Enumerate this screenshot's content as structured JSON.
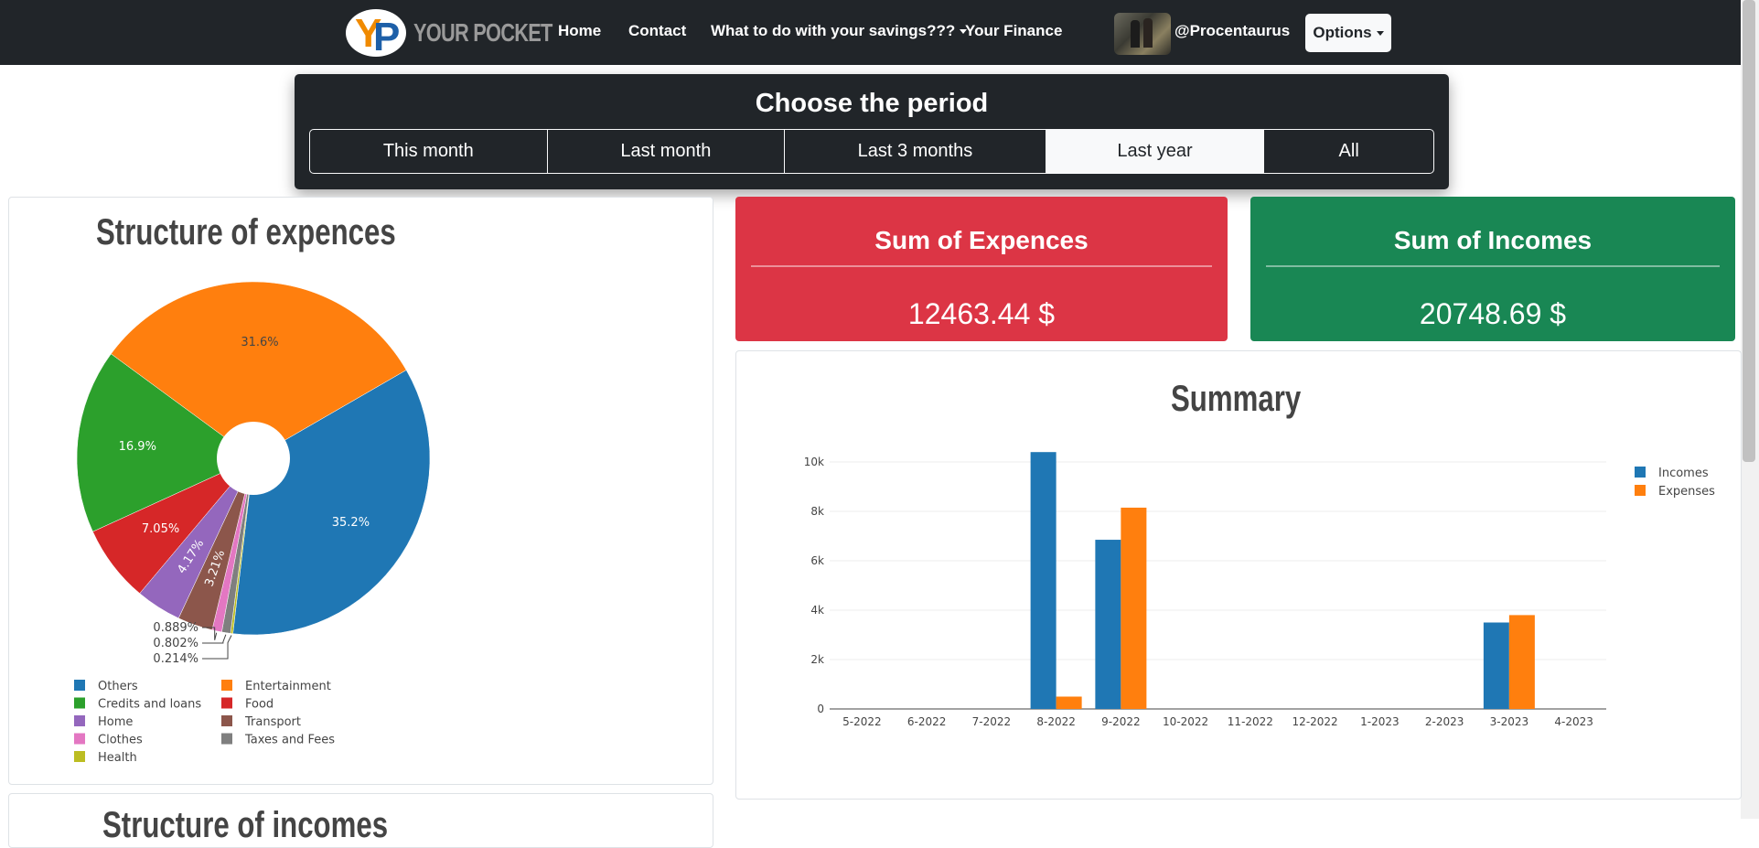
{
  "navbar": {
    "brand_text": "YOUR POCKET",
    "links": [
      {
        "label": "Home"
      },
      {
        "label": "Contact"
      },
      {
        "label": "What to do with your savings???"
      },
      {
        "label": "Your Finance"
      }
    ],
    "username": "@Procentaurus",
    "options_label": "Options"
  },
  "period": {
    "title": "Choose the period",
    "buttons": [
      "This month",
      "Last month",
      "Last 3 months",
      "Last year",
      "All"
    ],
    "active": "Last year"
  },
  "expenses_card": {
    "title": "Structure of expences",
    "next_title": "Structure of incomes"
  },
  "sum_expenses": {
    "title": "Sum of Expences",
    "value": "12463.44 $",
    "color": "#dc3545"
  },
  "sum_incomes": {
    "title": "Sum of Incomes",
    "value": "20748.69 $",
    "color": "#198754"
  },
  "summary_card": {
    "title": "Summary"
  },
  "chart_data": [
    {
      "type": "pie",
      "title": "Structure of expences",
      "hole": true,
      "slices": [
        {
          "label": "Others",
          "value": 35.2,
          "text": "35.2%",
          "color": "#1f77b4"
        },
        {
          "label": "Health",
          "value": 0.214,
          "text": "0.214%",
          "color": "#bcbd22"
        },
        {
          "label": "Taxes and Fees",
          "value": 0.802,
          "text": "0.802%",
          "color": "#7f7f7f"
        },
        {
          "label": "Clothes",
          "value": 0.889,
          "text": "0.889%",
          "color": "#e377c2"
        },
        {
          "label": "Transport",
          "value": 3.21,
          "text": "3.21%",
          "color": "#8c564b"
        },
        {
          "label": "Home",
          "value": 4.17,
          "text": "4.17%",
          "color": "#9467bd"
        },
        {
          "label": "Food",
          "value": 7.05,
          "text": "7.05%",
          "color": "#d62728"
        },
        {
          "label": "Credits and loans",
          "value": 16.9,
          "text": "16.9%",
          "color": "#2ca02c"
        },
        {
          "label": "Entertainment",
          "value": 31.6,
          "text": "31.6%",
          "color": "#ff7f0e"
        }
      ],
      "legend": [
        {
          "label": "Others",
          "color": "#1f77b4"
        },
        {
          "label": "Entertainment",
          "color": "#ff7f0e"
        },
        {
          "label": "Credits and loans",
          "color": "#2ca02c"
        },
        {
          "label": "Food",
          "color": "#d62728"
        },
        {
          "label": "Home",
          "color": "#9467bd"
        },
        {
          "label": "Transport",
          "color": "#8c564b"
        },
        {
          "label": "Clothes",
          "color": "#e377c2"
        },
        {
          "label": "Taxes and Fees",
          "color": "#7f7f7f"
        },
        {
          "label": "Health",
          "color": "#bcbd22"
        }
      ],
      "legend_placement": "bottom"
    },
    {
      "type": "bar",
      "title": "Summary",
      "categories": [
        "5-2022",
        "6-2022",
        "7-2022",
        "8-2022",
        "9-2022",
        "10-2022",
        "11-2022",
        "12-2022",
        "1-2023",
        "2-2023",
        "3-2023",
        "4-2023"
      ],
      "series": [
        {
          "name": "Incomes",
          "color": "#1f77b4",
          "values": [
            0,
            0,
            0,
            10400,
            6850,
            0,
            0,
            0,
            0,
            0,
            3500,
            0
          ]
        },
        {
          "name": "Expenses",
          "color": "#ff7f0e",
          "values": [
            0,
            0,
            0,
            500,
            8150,
            0,
            0,
            0,
            0,
            0,
            3800,
            0
          ]
        }
      ],
      "ylim": [
        0,
        11000
      ],
      "yticks": [
        0,
        2000,
        4000,
        6000,
        8000,
        10000
      ],
      "ytick_labels": [
        "0",
        "2k",
        "4k",
        "6k",
        "8k",
        "10k"
      ],
      "grid": true,
      "legend_placement": "top-right"
    }
  ]
}
